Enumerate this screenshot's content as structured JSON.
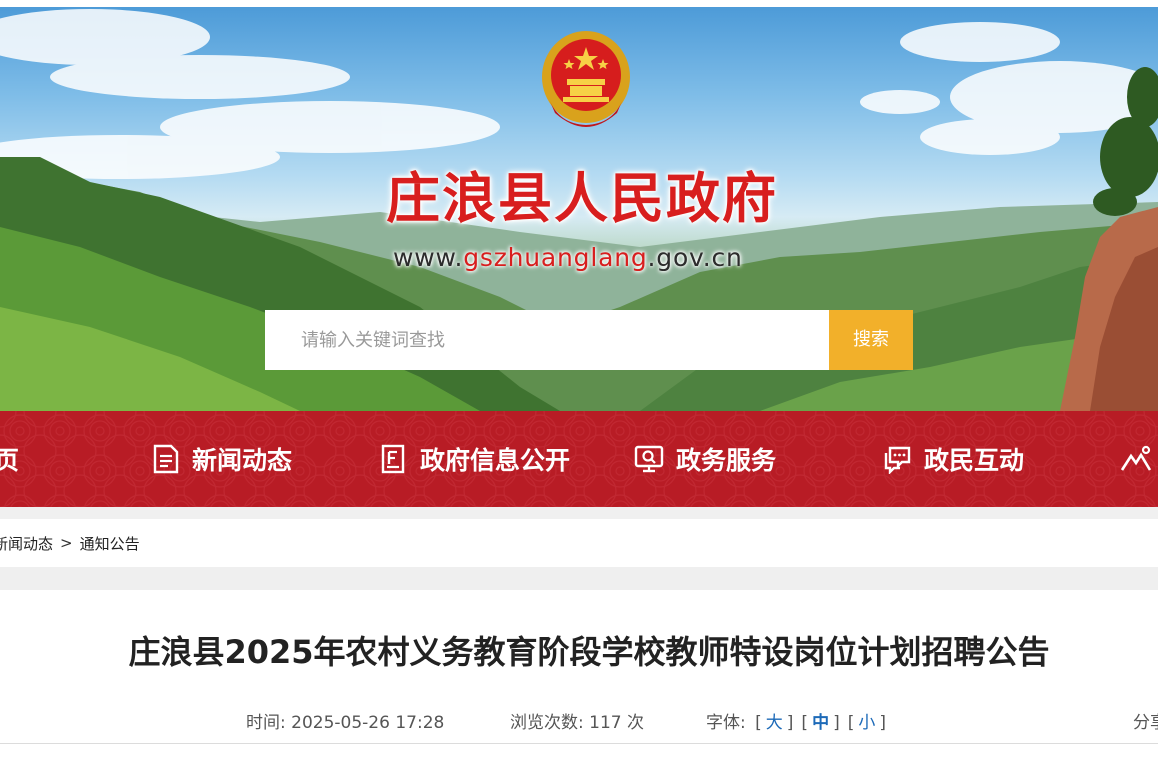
{
  "site": {
    "title": "庄浪县人民政府",
    "url_prefix": "www.",
    "url_domain": "gszhuanglang",
    "url_suffix": ".gov.cn"
  },
  "search": {
    "placeholder": "请输入关键词查找",
    "button_label": "搜索"
  },
  "nav": {
    "items": [
      {
        "label": "页",
        "icon": "home-icon"
      },
      {
        "label": "新闻动态",
        "icon": "news-document-icon"
      },
      {
        "label": "政府信息公开",
        "icon": "info-disclosure-icon"
      },
      {
        "label": "政务服务",
        "icon": "service-monitor-icon"
      },
      {
        "label": "政民互动",
        "icon": "chat-bubbles-icon"
      },
      {
        "label": "",
        "icon": "mountain-icon"
      }
    ]
  },
  "breadcrumb": {
    "items": [
      "新闻动态",
      "通知公告"
    ],
    "separator": ">"
  },
  "article": {
    "title": "庄浪县2025年农村义务教育阶段学校教师特设岗位计划招聘公告",
    "time_label": "时间:",
    "time_value": "2025-05-26 17:28",
    "views_label": "浏览次数:",
    "views_value": "117 次",
    "font_label": "字体:",
    "font_sizes": [
      "大",
      "中",
      "小"
    ],
    "font_active": "中",
    "share_label": "分享"
  },
  "colors": {
    "nav_red": "#b81c25",
    "title_red": "#d81e1e",
    "search_button": "#f2b02a",
    "font_link_blue": "#1d6ab8"
  }
}
